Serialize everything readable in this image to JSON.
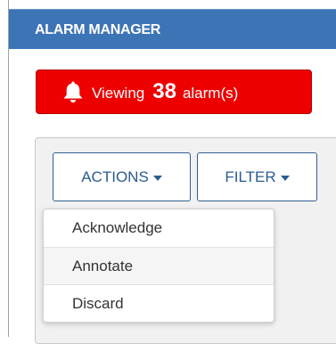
{
  "header": {
    "title": "ALARM MANAGER"
  },
  "alarm_banner": {
    "prefix": "Viewing",
    "count": "38",
    "suffix": "alarm(s)",
    "icon": "bell-icon",
    "color": "#ee0000"
  },
  "toolbar": {
    "actions_label": "ACTIONS",
    "filter_label": "FILTER"
  },
  "actions_menu": {
    "items": [
      {
        "label": "Acknowledge"
      },
      {
        "label": "Annotate"
      },
      {
        "label": "Discard"
      }
    ],
    "highlighted_item": "Annotate"
  },
  "colors": {
    "header_bg": "#3d74b6",
    "button_text": "#2a5c90"
  }
}
